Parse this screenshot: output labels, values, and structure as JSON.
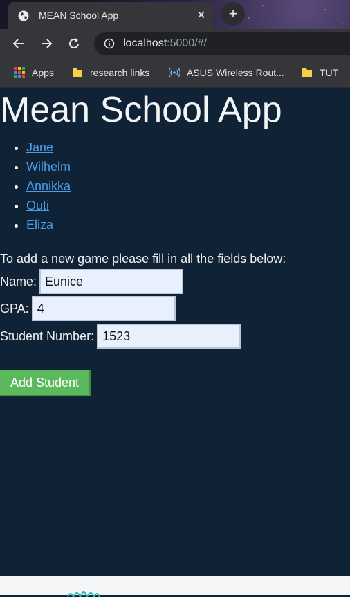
{
  "browser": {
    "tab_title": "MEAN School App",
    "url_host": "localhost",
    "url_path": ":5000/#/",
    "new_tab_symbol": "+",
    "close_symbol": "✕",
    "bookmarks": [
      "Apps",
      "research links",
      "ASUS Wireless Rout...",
      "TUT"
    ]
  },
  "page": {
    "heading": "Mean School App",
    "students": [
      "Jane",
      "Wilhelm",
      "Annikka",
      "Outi",
      "Eliza"
    ],
    "intro": "To add a new game please fill in all the fields below:",
    "form": {
      "name_label": "Name:",
      "name_value": "Eunice",
      "gpa_label": "GPA:",
      "gpa_value": "4",
      "student_number_label": "Student Number:",
      "student_number_value": "1523",
      "submit_label": "Add Student"
    }
  },
  "colors": {
    "page_background": "#0f2236",
    "link": "#4a9fe8",
    "button": "#5cb85c"
  }
}
